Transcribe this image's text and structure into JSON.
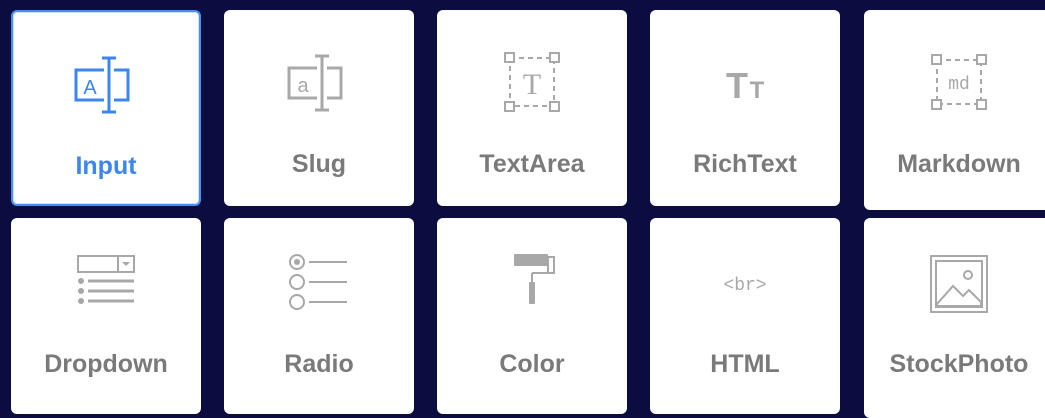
{
  "fields": [
    {
      "label": "Input",
      "icon": "input-icon",
      "selected": true
    },
    {
      "label": "Slug",
      "icon": "slug-icon",
      "selected": false
    },
    {
      "label": "TextArea",
      "icon": "textarea-icon",
      "selected": false
    },
    {
      "label": "RichText",
      "icon": "richtext-icon",
      "selected": false
    },
    {
      "label": "Markdown",
      "icon": "markdown-icon",
      "selected": false
    },
    {
      "label": "Dropdown",
      "icon": "dropdown-icon",
      "selected": false
    },
    {
      "label": "Radio",
      "icon": "radio-icon",
      "selected": false
    },
    {
      "label": "Color",
      "icon": "paint-roller-icon",
      "selected": false
    },
    {
      "label": "HTML",
      "icon": "html-tag-icon",
      "selected": false
    },
    {
      "label": "StockPhoto",
      "icon": "image-icon",
      "selected": false
    }
  ],
  "icon_text": {
    "input": "A",
    "slug": "a",
    "textarea": "T",
    "richtext_big": "T",
    "richtext_small": "T",
    "markdown": "md",
    "html": "<br>"
  },
  "colors": {
    "background": "#0b0c3f",
    "tile": "#ffffff",
    "selected_accent": "#3d86f0",
    "icon_gray": "#a8a8a8",
    "label_gray": "#7a7a7a"
  }
}
